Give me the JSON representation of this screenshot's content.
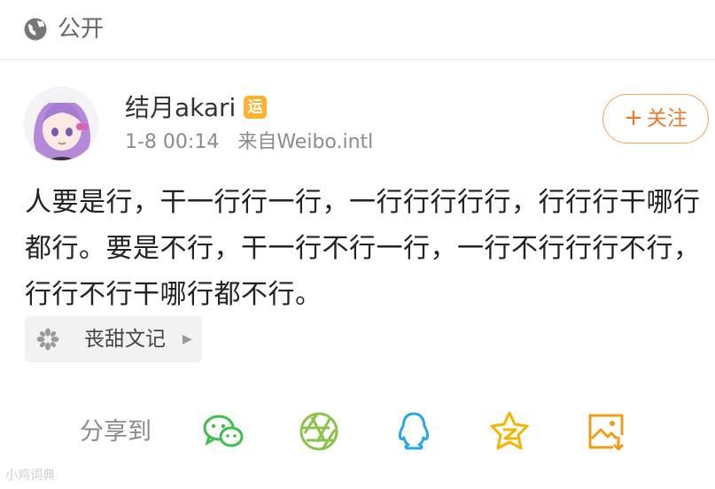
{
  "header": {
    "visibility": "公开",
    "visibility_icon": "globe-icon"
  },
  "post": {
    "author": "结月akari",
    "badge": "运",
    "time": "1-8 00:14",
    "source": "来自Weibo.intl",
    "follow_label": "关注",
    "text": "人要是行，干一行行一行，一行行行行行，行行行干哪行都行。要是不行，干一行不行一行，一行不行行行不行，行行不行干哪行都不行。",
    "tag": {
      "label": "丧甜文记",
      "icon": "topic-icon"
    }
  },
  "share": {
    "label": "分享到",
    "targets": [
      "wechat-icon",
      "moments-icon",
      "qq-icon",
      "qzone-icon",
      "save-image-icon"
    ]
  },
  "watermark": "小鸡词典",
  "colors": {
    "accent": "#f0782d",
    "wechat": "#3cbf4e",
    "moments": "#8bc34a",
    "qq": "#2aa7e8",
    "qzone": "#f5b400",
    "save": "#f39c12"
  }
}
